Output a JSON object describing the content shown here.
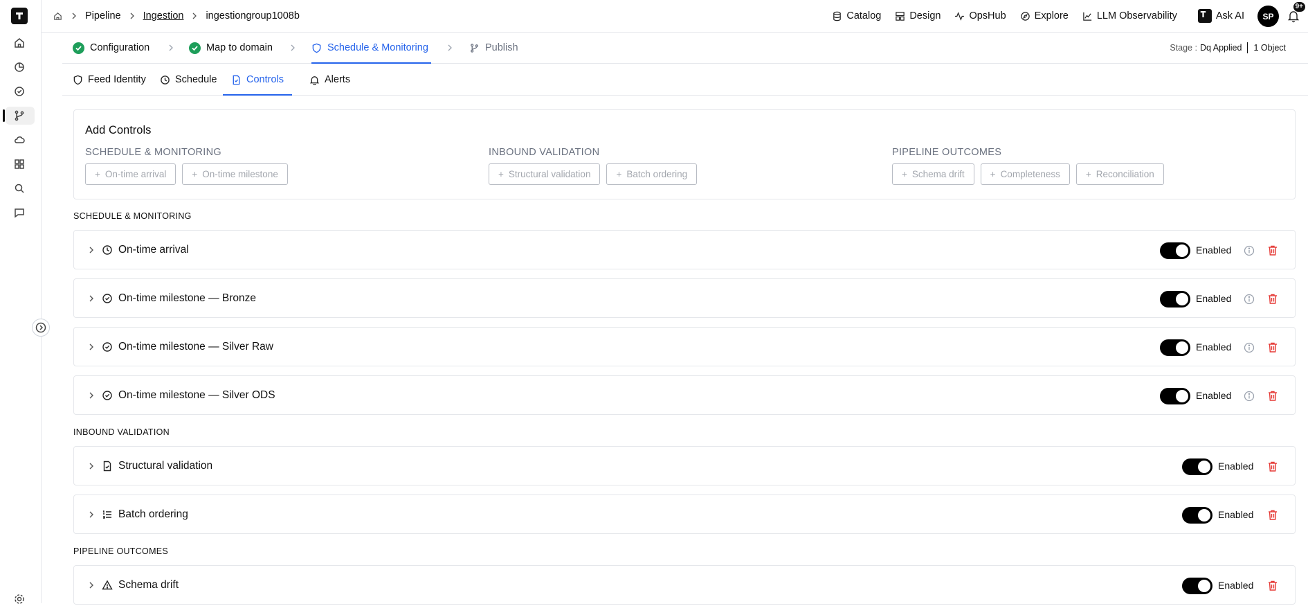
{
  "rail": {
    "nav": [
      "home-icon",
      "analytics-icon",
      "check-circle-icon",
      "pipeline-icon",
      "cloud-icon",
      "grid-icon",
      "search-icon",
      "chat-icon"
    ],
    "settings": "gear-icon"
  },
  "breadcrumb": {
    "items": [
      "Pipeline",
      "Ingestion",
      "ingestiongroup1008b"
    ]
  },
  "topnav": {
    "catalog": "Catalog",
    "design": "Design",
    "opshub": "OpsHub",
    "explore": "Explore",
    "llm": "LLM Observability",
    "ask_ai": "Ask AI",
    "avatar": "SP",
    "notifications": "9+"
  },
  "stepper": {
    "steps": [
      "Configuration",
      "Map to domain",
      "Schedule & Monitoring",
      "Publish"
    ],
    "stage_label": "Stage :",
    "stage_value": "Dq Applied",
    "objects": "1 Object"
  },
  "tabs": [
    "Feed Identity",
    "Schedule",
    "Controls",
    "Alerts"
  ],
  "add_controls": {
    "title": "Add Controls",
    "groups": [
      {
        "title": "SCHEDULE & MONITORING",
        "buttons": [
          "On-time arrival",
          "On-time milestone"
        ]
      },
      {
        "title": "INBOUND VALIDATION",
        "buttons": [
          "Structural validation",
          "Batch ordering"
        ]
      },
      {
        "title": "PIPELINE OUTCOMES",
        "buttons": [
          "Schema drift",
          "Completeness",
          "Reconciliation"
        ]
      }
    ]
  },
  "sections": {
    "schedule": "SCHEDULE & MONITORING",
    "inbound": "INBOUND VALIDATION",
    "outcomes": "PIPELINE OUTCOMES"
  },
  "controls": {
    "schedule": [
      {
        "label": "On-time arrival",
        "status": "Enabled",
        "icon": "clock-icon"
      },
      {
        "label": "On-time milestone — Bronze",
        "status": "Enabled",
        "icon": "check-circle-icon"
      },
      {
        "label": "On-time milestone — Silver Raw",
        "status": "Enabled",
        "icon": "check-circle-icon"
      },
      {
        "label": "On-time milestone — Silver ODS",
        "status": "Enabled",
        "icon": "check-circle-icon"
      }
    ],
    "inbound": [
      {
        "label": "Structural validation",
        "status": "Enabled",
        "icon": "file-check-icon"
      },
      {
        "label": "Batch ordering",
        "status": "Enabled",
        "icon": "list-ordered-icon"
      }
    ],
    "outcomes": [
      {
        "label": "Schema drift",
        "status": "Enabled",
        "icon": "warning-icon"
      }
    ]
  },
  "colors": {
    "accent": "#2563eb",
    "success": "#1e9e5a",
    "danger": "#e53935",
    "toggle_on": "#000000"
  }
}
